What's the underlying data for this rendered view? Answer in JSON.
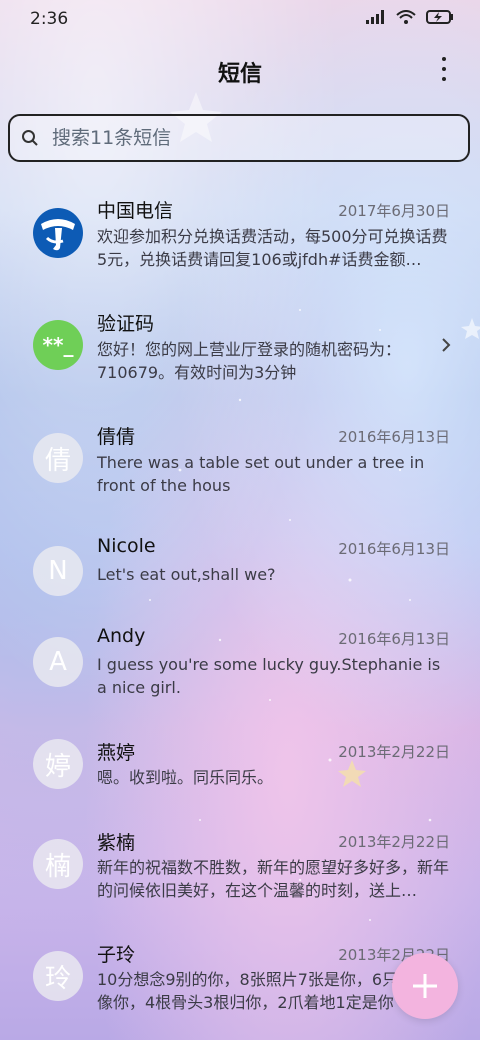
{
  "status_bar": {
    "time": "2:36"
  },
  "header": {
    "title": "短信"
  },
  "search": {
    "placeholder": "搜索11条短信"
  },
  "conversations": [
    {
      "name": "中国电信",
      "date": "2017年6月30日",
      "snippet": "欢迎参加积分兑换话费活动，每500分可兑换话费5元，兑换话费请回复106或jfdh#话费金额…",
      "avatar_text": "",
      "avatar_icon": "china-telecom-logo"
    },
    {
      "name": "验证码",
      "date": "",
      "snippet": "您好！您的网上营业厅登录的随机密码为：710679。有效时间为3分钟",
      "avatar_text": "**_",
      "avatar_color": "#6fcf57"
    },
    {
      "name": "倩倩",
      "date": "2016年6月13日",
      "snippet": "There was a table set out under a tree in front of the hous",
      "avatar_text": "倩"
    },
    {
      "name": "Nicole",
      "date": "2016年6月13日",
      "snippet": "Let's eat out,shall we?",
      "avatar_text": "N"
    },
    {
      "name": "Andy",
      "date": "2016年6月13日",
      "snippet": "I guess you're some lucky guy.Stephanie is a nice girl.",
      "avatar_text": "A"
    },
    {
      "name": "燕婷",
      "date": "2013年2月22日",
      "snippet": "嗯。收到啦。同乐同乐。",
      "avatar_text": "婷"
    },
    {
      "name": "紫楠",
      "date": "2013年2月22日",
      "snippet": "新年的祝福数不胜数，新年的愿望好多好多，新年的问候依旧美好，在这个温馨的时刻，送上…",
      "avatar_text": "楠"
    },
    {
      "name": "子玲",
      "date": "2013年2月22日",
      "snippet": "10分想念9别的你，8张照片7张是你，6只眼睛只像你，4根骨头3根归你，2爪着地1定是你",
      "avatar_text": "玲"
    }
  ],
  "colors": {
    "fab": "#f3b4df",
    "verification_avatar": "#6fcf57",
    "telecom_blue": "#0d5bb5"
  },
  "icons": {
    "search": "search-icon",
    "more": "more-vertical-icon",
    "fab": "plus-icon",
    "chevron": "chevron-right-icon"
  }
}
